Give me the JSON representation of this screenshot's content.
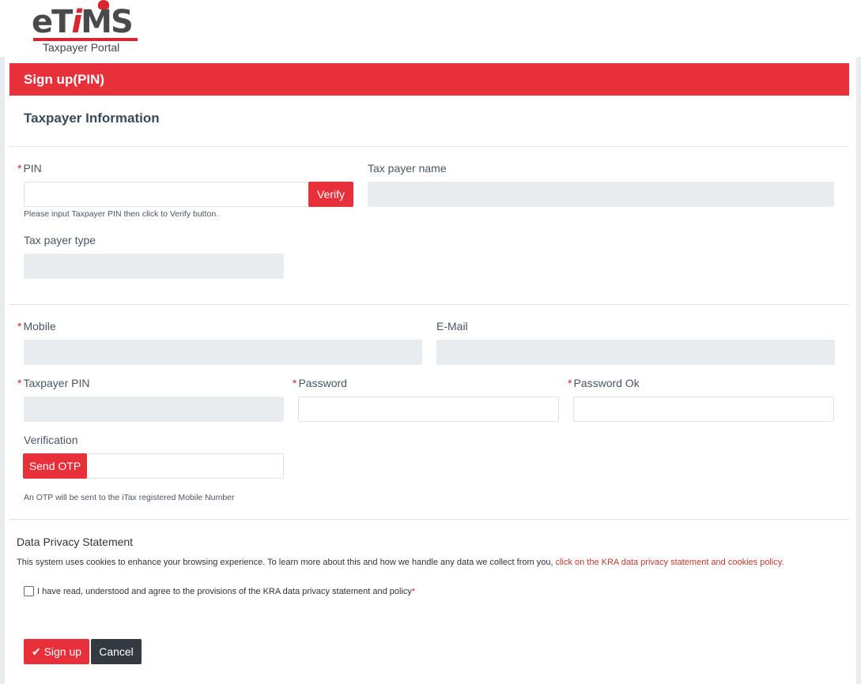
{
  "brand": {
    "logo_word_left": "eT",
    "logo_word_red": "i",
    "logo_word_right": "MS",
    "logo_subtitle": "Taxpayer Portal",
    "accent_color": "#e8303a"
  },
  "form": {
    "title": "Sign up(PIN)",
    "section_title": "Taxpayer Information",
    "pin": {
      "label": "PIN",
      "value": "",
      "hint": "Please input Taxpayer PIN then click to Verify button."
    },
    "verify_button": "Verify",
    "taxpayer_name": {
      "label": "Tax payer name",
      "value": ""
    },
    "taxpayer_type": {
      "label": "Tax payer type",
      "value": ""
    },
    "mobile": {
      "label": "Mobile",
      "value": ""
    },
    "email": {
      "label": "E-Mail",
      "value": ""
    },
    "taxpayer_pin": {
      "label": "Taxpayer PIN",
      "value": ""
    },
    "password": {
      "label": "Password",
      "value": ""
    },
    "password_ok": {
      "label": "Password Ok",
      "value": ""
    },
    "verification": {
      "label": "Verification",
      "value": "",
      "hint": "An OTP will be sent to the iTax registered Mobile Number"
    },
    "send_otp_button": "Send OTP",
    "required_mark": "*"
  },
  "privacy": {
    "title": "Data Privacy Statement",
    "text": "This system uses cookies to enhance your browsing experience. To learn more about this and how we handle any data we collect from you, ",
    "link": "click on the KRA data privacy statement and cookies policy.",
    "agree_text": "I have read, understood and agree to the provisions of the KRA data privacy statement and policy",
    "agree_checked": false
  },
  "actions": {
    "signup_icon": "check-icon",
    "signup_label": "Sign up",
    "cancel_label": "Cancel"
  }
}
